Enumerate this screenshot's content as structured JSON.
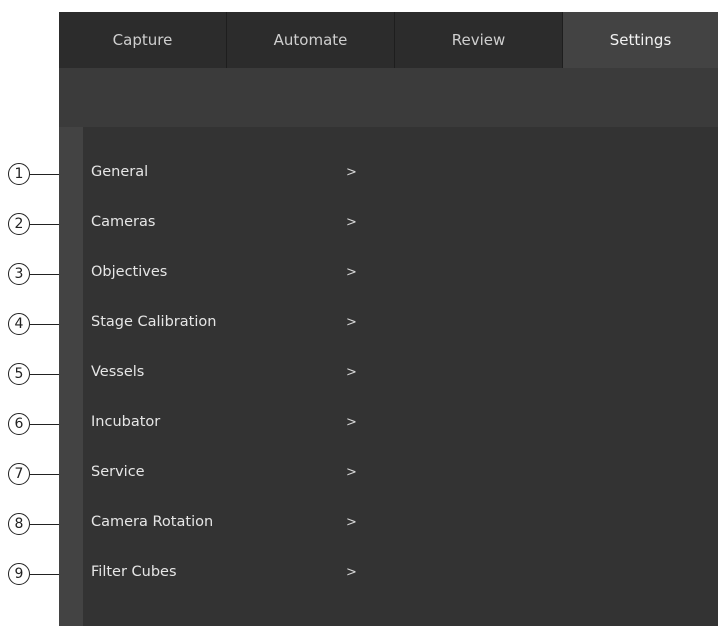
{
  "tabs": [
    {
      "label": "Capture",
      "active": false
    },
    {
      "label": "Automate",
      "active": false
    },
    {
      "label": "Review",
      "active": false
    },
    {
      "label": "Settings",
      "active": true
    }
  ],
  "settings_menu": {
    "items": [
      {
        "label": "General",
        "arrow": ">"
      },
      {
        "label": "Cameras",
        "arrow": ">"
      },
      {
        "label": "Objectives",
        "arrow": ">"
      },
      {
        "label": "Stage Calibration",
        "arrow": ">"
      },
      {
        "label": "Vessels",
        "arrow": ">"
      },
      {
        "label": "Incubator",
        "arrow": ">"
      },
      {
        "label": "Service",
        "arrow": ">"
      },
      {
        "label": "Camera Rotation",
        "arrow": ">"
      },
      {
        "label": "Filter Cubes",
        "arrow": ">"
      }
    ]
  },
  "callouts": [
    "1",
    "2",
    "3",
    "4",
    "5",
    "6",
    "7",
    "8",
    "9"
  ],
  "colors": {
    "tabbar_bg": "#2c2c2c",
    "active_tab_bg": "#434343",
    "panel_bg": "#333333",
    "text": "#e6e6e6"
  }
}
